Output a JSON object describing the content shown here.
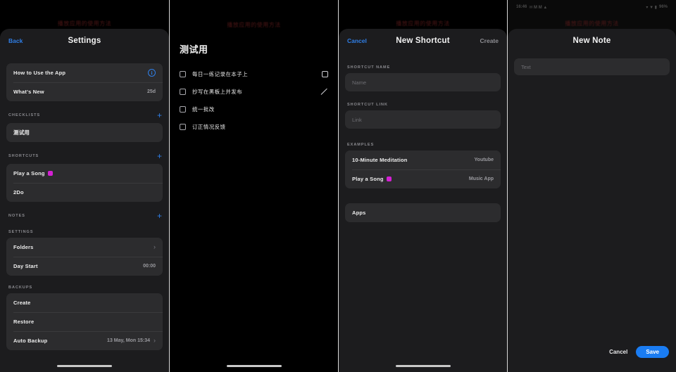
{
  "panel1": {
    "watermark": "播放应用的使用方法",
    "nav": {
      "back": "Back",
      "title": "Settings"
    },
    "help_card": [
      {
        "label": "How to Use the App",
        "value": "",
        "icon": "info-icon"
      },
      {
        "label": "What's New",
        "value": "25d",
        "icon": ""
      }
    ],
    "checklists": {
      "header": "CHECKLISTS",
      "add": "+",
      "items": [
        {
          "label": "测试用"
        }
      ]
    },
    "shortcuts": {
      "header": "SHORTCUTS",
      "add": "+",
      "items": [
        {
          "label": "Play a Song",
          "badge": "music-badge"
        },
        {
          "label": "2Do",
          "badge": ""
        }
      ]
    },
    "notes": {
      "header": "NOTES",
      "add": "+"
    },
    "settings": {
      "header": "SETTINGS",
      "items": [
        {
          "label": "Folders",
          "value": "",
          "chevron": "›"
        },
        {
          "label": "Day Start",
          "value": "00:00",
          "chevron": ""
        }
      ]
    },
    "backups": {
      "header": "BACKUPS",
      "items": [
        {
          "label": "Create",
          "value": "",
          "chevron": ""
        },
        {
          "label": "Restore",
          "value": "",
          "chevron": ""
        },
        {
          "label": "Auto Backup",
          "value": "13 May, Mon 15:34",
          "chevron": "›"
        }
      ]
    }
  },
  "panel2": {
    "watermark": "播放应用的使用方法",
    "title": "测试用",
    "items": [
      {
        "text": "每日一练记录在本子上",
        "trailing": "checkbox-icon"
      },
      {
        "text": "抄写在黑板上并发布",
        "trailing": "pencil-icon"
      },
      {
        "text": "统一批改",
        "trailing": ""
      },
      {
        "text": "订正情况反馈",
        "trailing": ""
      }
    ]
  },
  "panel3": {
    "watermark": "播放应用的使用方法",
    "nav": {
      "cancel": "Cancel",
      "title": "New Shortcut",
      "create": "Create"
    },
    "name_field": {
      "label": "SHORTCUT NAME",
      "value": "",
      "placeholder": "Name"
    },
    "link_field": {
      "label": "SHORTCUT LINK",
      "value": "",
      "placeholder": "Link"
    },
    "examples": {
      "header": "EXAMPLES",
      "items": [
        {
          "label": "10-Minute Meditation",
          "badge": "",
          "source": "Youtube"
        },
        {
          "label": "Play a Song",
          "badge": "music-badge",
          "source": "Music App"
        }
      ]
    },
    "apps_row": {
      "label": "Apps"
    }
  },
  "panel4": {
    "watermark": "播放应用的使用方法",
    "statusbar": {
      "time": "16:46",
      "left_icons": "✉ M M ▲",
      "right_icons": "▾ ▼ ▮",
      "battery": "96%"
    },
    "title": "New Note",
    "text_field": {
      "value": "",
      "placeholder": "Text"
    },
    "cancel_label": "Cancel",
    "save_label": "Save"
  },
  "colors": {
    "accent_blue": "#2f7fe8",
    "save_blue": "#1a7cf2",
    "badge_magenta": "#d420d4",
    "sheet_bg": "#1c1c1e",
    "card_bg": "#2c2c2e"
  }
}
